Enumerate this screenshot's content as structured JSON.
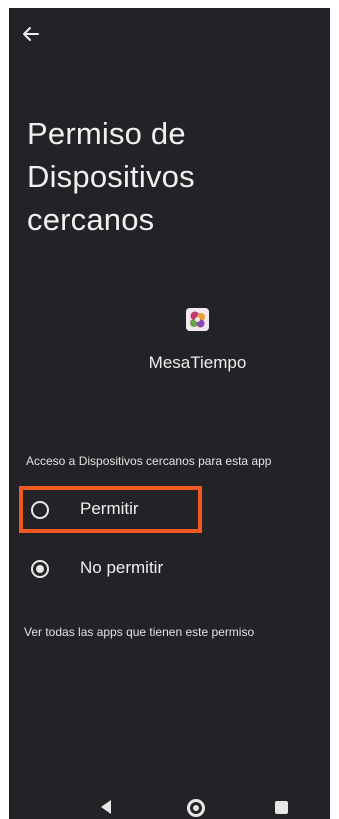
{
  "header": {
    "back_icon": "arrow-back-icon",
    "title": "Permiso de Dispositivos cercanos"
  },
  "app": {
    "icon": "app-logo-icon",
    "name": "MesaTiempo"
  },
  "permission": {
    "section_label": "Acceso a Dispositivos cercanos para esta app",
    "options": [
      {
        "label": "Permitir",
        "selected": false
      },
      {
        "label": "No permitir",
        "selected": true
      }
    ],
    "highlight_color": "#f05a22"
  },
  "footer": {
    "see_all_link": "Ver todas las apps que tienen este permiso"
  },
  "navbar": {
    "icons": [
      "nav-back-icon",
      "nav-home-icon",
      "nav-recents-icon"
    ]
  },
  "colors": {
    "background": "#222326",
    "text": "#ececec",
    "highlight": "#f05a22"
  }
}
